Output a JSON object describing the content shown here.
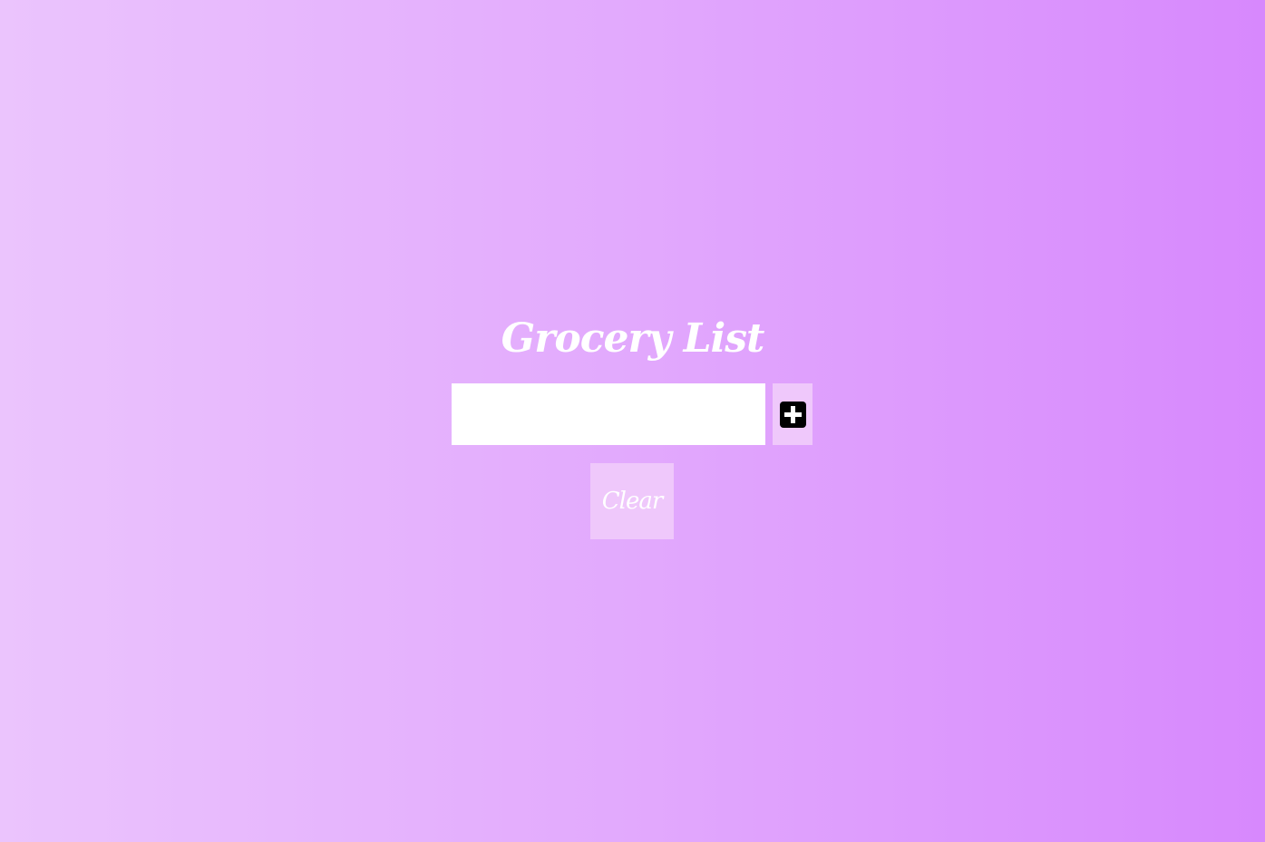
{
  "app": {
    "title": "Grocery List"
  },
  "input": {
    "value": "",
    "placeholder": ""
  },
  "add_button": {
    "icon": "plus-square-icon"
  },
  "clear_button": {
    "label": "Clear"
  },
  "colors": {
    "background_left": "#ebc4fd",
    "background_right": "#d788fd",
    "button_bg": "#efc8fb",
    "title_text": "#ffffff",
    "icon": "#000000"
  }
}
